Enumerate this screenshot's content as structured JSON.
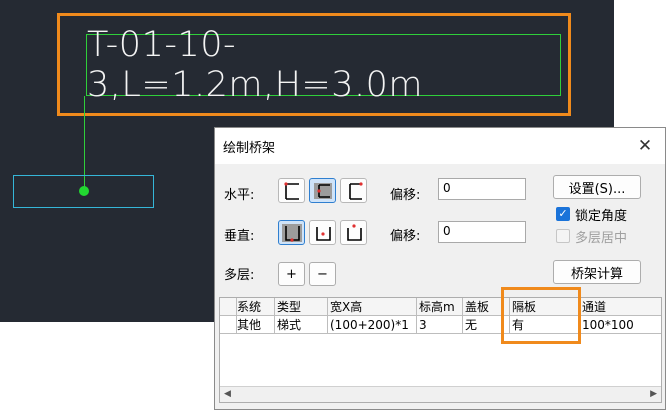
{
  "cad": {
    "tray_label": "T-01-10-3,L=1.2m,H=3.0m"
  },
  "dialog": {
    "title": "绘制桥架",
    "close_glyph": "✕",
    "horizontal_label": "水平:",
    "vertical_label": "垂直:",
    "multilayer_label": "多层:",
    "offset_label": "偏移:",
    "h_offset_value": "0",
    "v_offset_value": "0",
    "settings_button": "设置(S)...",
    "lock_angle_label": "锁定角度",
    "lock_angle_checked": true,
    "multilayer_center_label": "多层居中",
    "multilayer_center_checked": false,
    "add_button": "+",
    "remove_button": "−",
    "calc_button": "桥架计算",
    "horizontal_icons": [
      "tray-align-top-left-icon",
      "tray-align-center-icon",
      "tray-align-right-icon"
    ],
    "vertical_icons": [
      "tray-align-bottom-icon",
      "tray-align-middle-icon",
      "tray-align-top-icon"
    ],
    "selected_horizontal": 1,
    "selected_vertical": 0
  },
  "grid": {
    "headers": [
      "系统",
      "类型",
      "宽X高",
      "标高m",
      "盖板",
      "隔板",
      "通道"
    ],
    "row": [
      "其他",
      "梯式",
      "(100+200)*1",
      "3",
      "无",
      "有",
      "100*100"
    ]
  },
  "colors": {
    "cad_background": "#252a33",
    "highlight": "#f08a1c",
    "tray_text_frame": "#2fcf3a",
    "tray_outline": "#35b6d8",
    "selected_button": "#cfe3f8",
    "checkbox_on": "#1a73d9"
  }
}
